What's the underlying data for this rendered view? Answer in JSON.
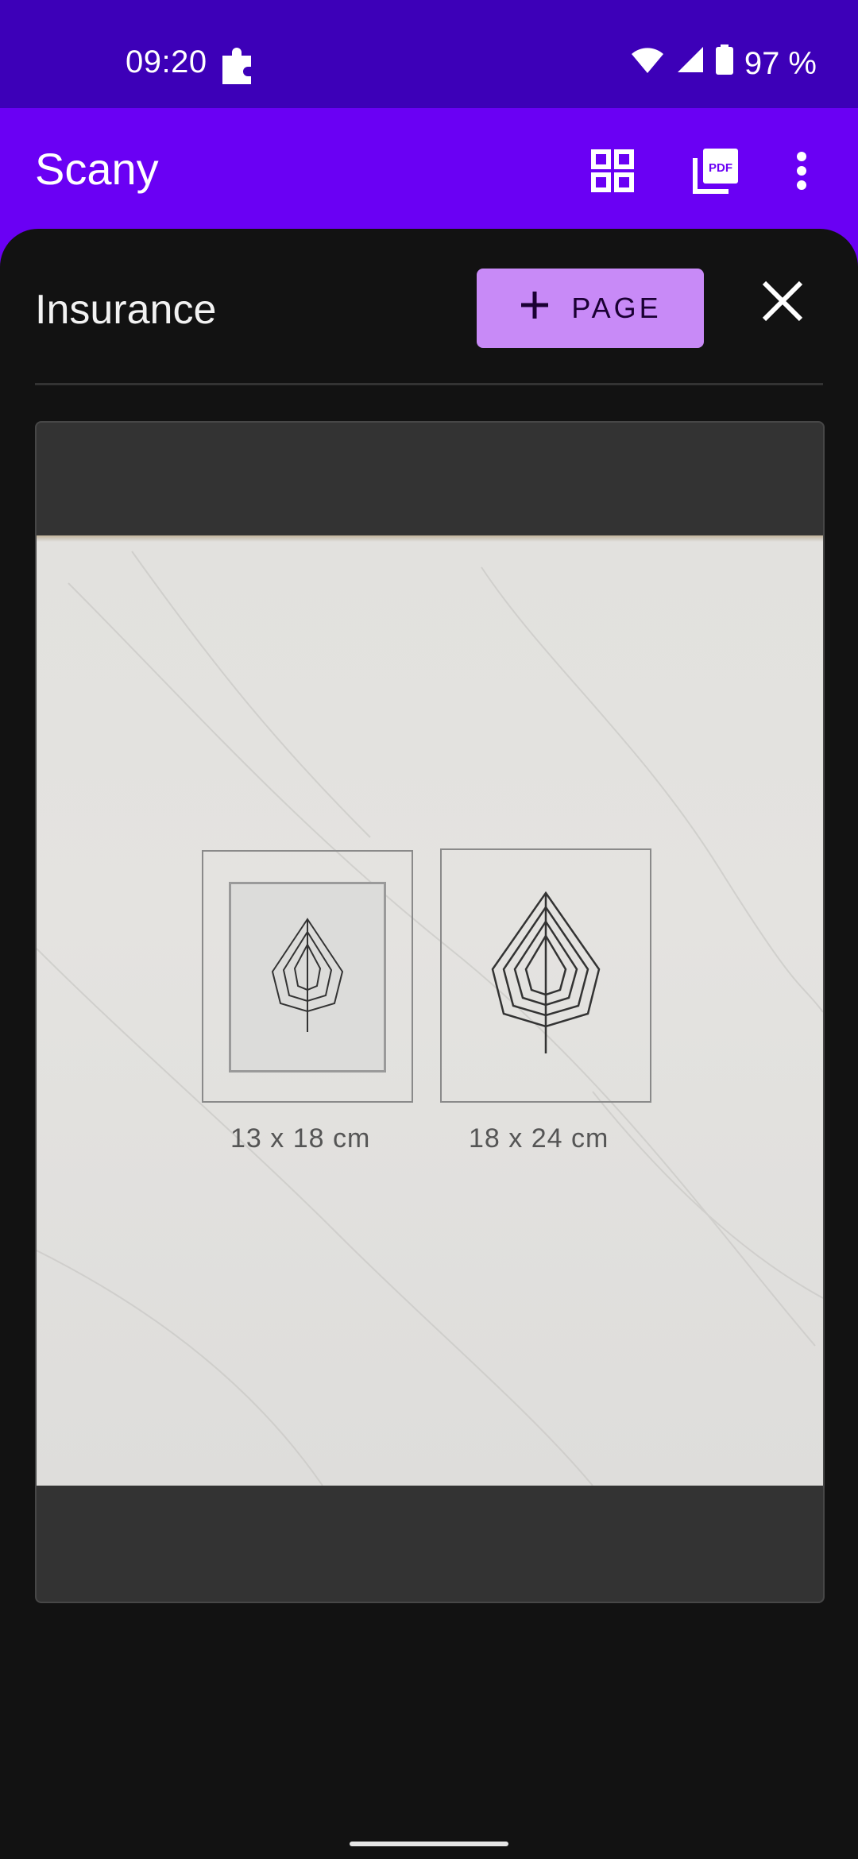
{
  "status_bar": {
    "time": "09:20",
    "battery": "97 %"
  },
  "app_bar": {
    "title": "Scany",
    "icons": [
      "grid-view-icon",
      "pdf-icon",
      "more-vert-icon"
    ]
  },
  "document": {
    "title": "Insurance",
    "add_page_label": "PAGE",
    "scan": {
      "frames": [
        {
          "label": "13 x 18 cm"
        },
        {
          "label": "18 x 24 cm"
        }
      ]
    }
  },
  "colors": {
    "status_bar": "#3d00b8",
    "app_bar": "#6a00f4",
    "sheet": "#121212",
    "accent_button": "#c88af7"
  }
}
